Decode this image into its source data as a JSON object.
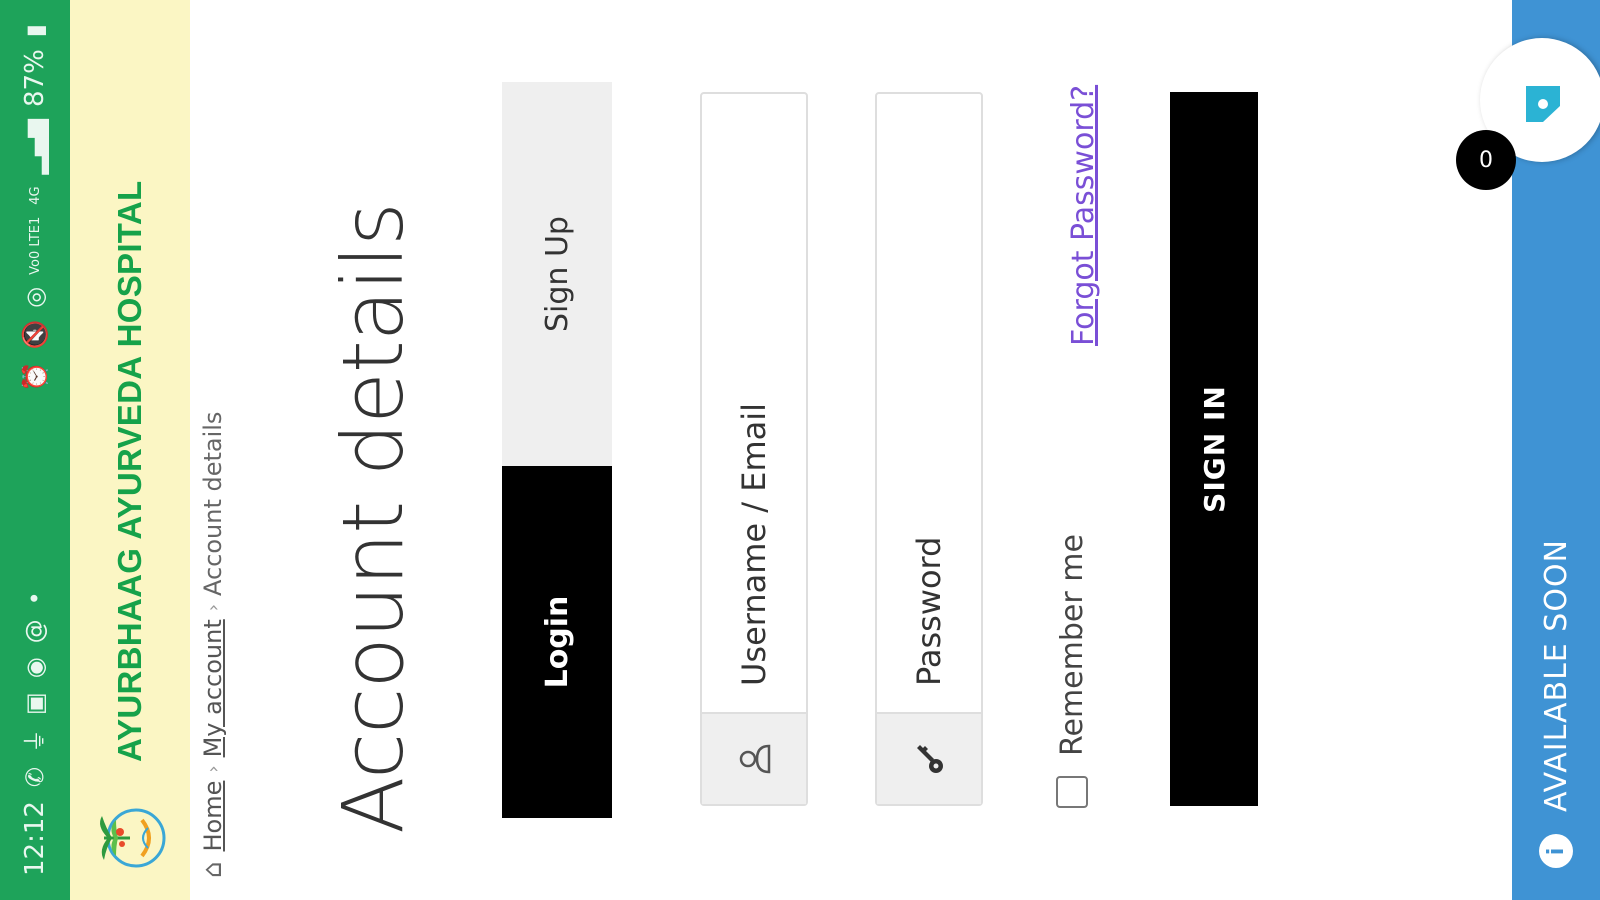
{
  "status_bar": {
    "time": "12:12",
    "battery": "87%",
    "network_volte": "Vo0 LTE1",
    "network_4g": "4G",
    "icons": [
      "phone-icon",
      "usb-icon",
      "image-icon",
      "whatsapp-icon",
      "at-icon",
      "dot-icon",
      "alarm-icon",
      "mute-icon",
      "hotspot-icon",
      "signal-icon",
      "battery-icon"
    ]
  },
  "header": {
    "title": "AYURBHAAG AYURVEDA HOSPITAL",
    "logo_icon": "hospital-logo-icon"
  },
  "breadcrumb": {
    "home": "Home",
    "my_account": "My account",
    "current": "Account details",
    "separator": "›"
  },
  "page": {
    "title": "Account details"
  },
  "tabs": {
    "login": "Login",
    "signup": "Sign Up"
  },
  "form": {
    "username_placeholder": "Username / Email",
    "username_value": "",
    "password_placeholder": "Password",
    "password_value": "",
    "remember_me": "Remember me",
    "remember_checked": false,
    "forgot_password": "Forgot Password?",
    "sign_in": "SIGN IN"
  },
  "footer": {
    "notice": "AVAILABLE SOON",
    "cart_count": "0"
  },
  "colors": {
    "status_bar": "#1ea35a",
    "header_bg": "#fbf6c4",
    "brand_green": "#16a24a",
    "footer_blue": "#3f93d4",
    "link_purple": "#7a4fd6",
    "black": "#000000"
  }
}
